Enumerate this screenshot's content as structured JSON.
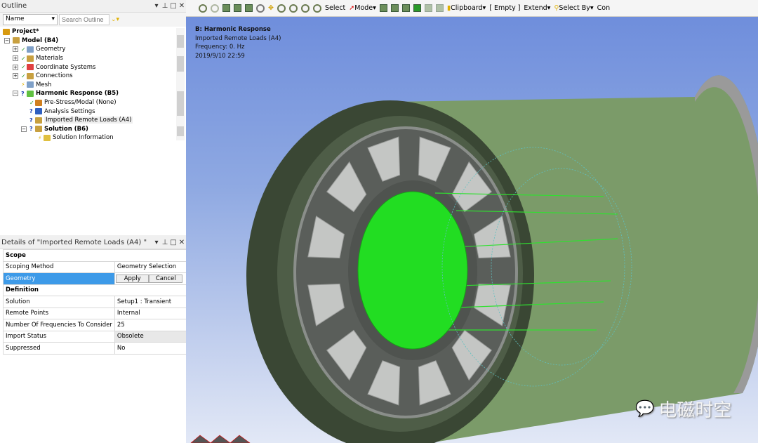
{
  "outline": {
    "title": "Outline",
    "filter_select": "Name",
    "search_placeholder": "Search Outline",
    "tree": [
      {
        "label": "Project*",
        "level": 0,
        "bold": true,
        "status": "",
        "icon": "project-icon",
        "color": "#d89a10"
      },
      {
        "label": "Model (B4)",
        "level": 1,
        "bold": true,
        "status": "",
        "icon": "model-icon",
        "color": "#c8a040",
        "expander": "-"
      },
      {
        "label": "Geometry",
        "level": 2,
        "status": "check",
        "icon": "geometry-icon",
        "color": "#7fa0c8",
        "expander": "+"
      },
      {
        "label": "Materials",
        "level": 2,
        "status": "check",
        "icon": "materials-icon",
        "color": "#c8a040",
        "expander": "+"
      },
      {
        "label": "Coordinate Systems",
        "level": 2,
        "status": "check",
        "icon": "coordinate-icon",
        "color": "#e04040",
        "expander": "+"
      },
      {
        "label": "Connections",
        "level": 2,
        "status": "check",
        "icon": "connections-icon",
        "color": "#c8a040",
        "expander": "+"
      },
      {
        "label": "Mesh",
        "level": 2,
        "status": "lightning",
        "icon": "mesh-icon",
        "color": "#7fa0c8"
      },
      {
        "label": "Harmonic Response (B5)",
        "level": 2,
        "bold": true,
        "status": "question",
        "icon": "harmonic-icon",
        "color": "#60c040",
        "expander": "-"
      },
      {
        "label": "Pre-Stress/Modal (None)",
        "level": 3,
        "status": "check",
        "icon": "prestress-icon",
        "color": "#d08020"
      },
      {
        "label": "Analysis Settings",
        "level": 3,
        "status": "question",
        "icon": "analysis-settings-icon",
        "color": "#3060c0"
      },
      {
        "label": "Imported Remote Loads (A4)",
        "level": 3,
        "status": "question",
        "icon": "imported-loads-icon",
        "color": "#c8a040",
        "selected": true
      },
      {
        "label": "Solution (B6)",
        "level": 3,
        "bold": true,
        "status": "question",
        "icon": "solution-icon",
        "color": "#c8a040",
        "expander": "-"
      },
      {
        "label": "Solution Information",
        "level": 4,
        "status": "lightning",
        "icon": "solution-info-icon",
        "color": "#e0c040"
      }
    ]
  },
  "details": {
    "title": "Details of \"Imported Remote Loads (A4) \"",
    "sections": [
      {
        "name": "Scope",
        "rows": [
          {
            "key": "Scoping Method",
            "value": "Geometry Selection"
          },
          {
            "key": "Geometry",
            "apply": "Apply",
            "cancel": "Cancel",
            "highlight": true
          }
        ]
      },
      {
        "name": "Definition",
        "rows": [
          {
            "key": "Solution",
            "value": "Setup1 : Transient"
          },
          {
            "key": "Remote Points",
            "value": "Internal"
          },
          {
            "key": "Number Of Frequencies To Consider",
            "value": "25"
          },
          {
            "key": "Import Status",
            "value": "Obsolete",
            "grey": true
          },
          {
            "key": "Suppressed",
            "value": "No"
          }
        ]
      }
    ]
  },
  "toolbar": {
    "select": "Select",
    "mode": "Mode",
    "clipboard": "Clipboard",
    "empty": "[ Empty ]",
    "extend": "Extend",
    "select_by": "Select By",
    "con": "Con"
  },
  "viewport": {
    "line1": "B: Harmonic Response",
    "line2": "Imported Remote Loads (A4)",
    "line3": "Frequency: 0. Hz",
    "line4": "2019/9/10 22:59",
    "watermark": "电磁时空"
  },
  "colors": {
    "rotor": "#22dd22",
    "body": "#7a9a6a",
    "selection": "#3d9ae8"
  }
}
